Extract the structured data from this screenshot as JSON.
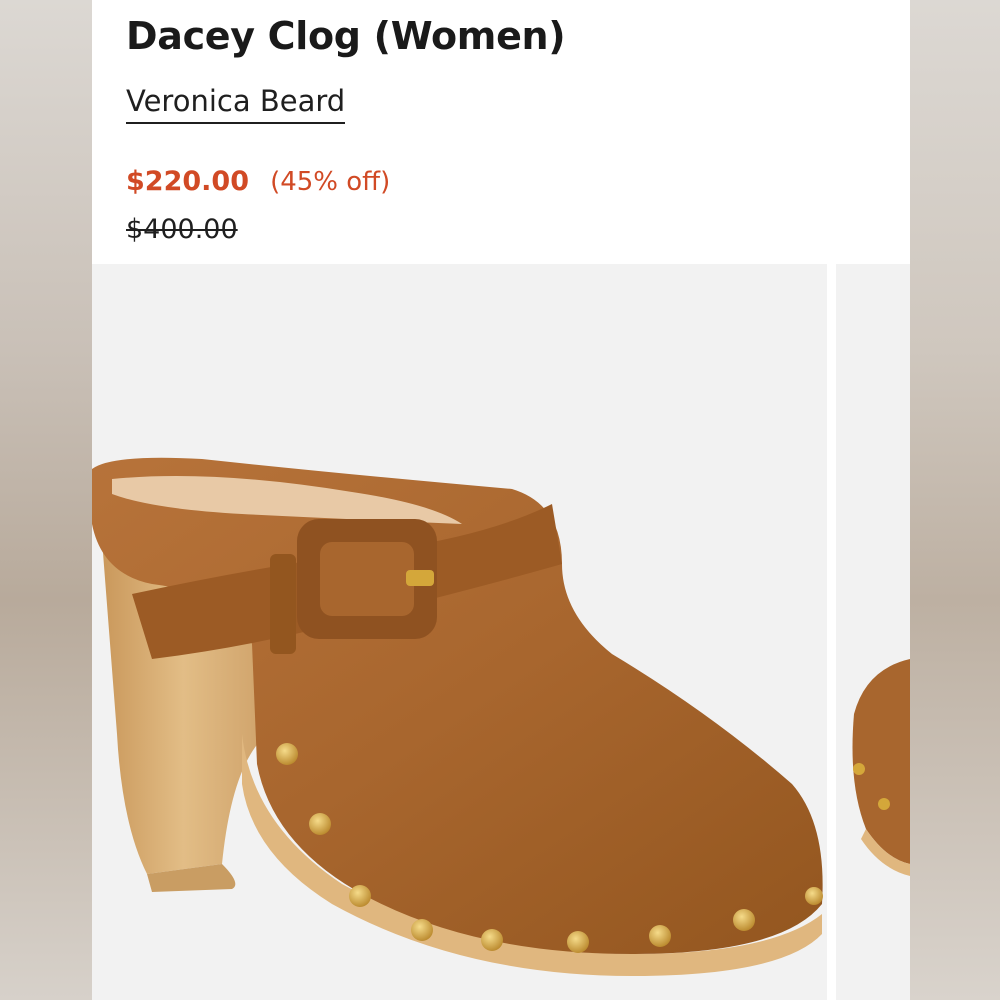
{
  "product": {
    "title": "Dacey Clog (Women)",
    "brand": "Veronica Beard",
    "sale_price": "$220.00",
    "discount": "(45% off)",
    "original_price": "$400.00"
  },
  "colors": {
    "sale": "#d14a25",
    "text": "#1a1a1a",
    "suede": "#a8662e",
    "wood": "#d9b27a",
    "stud": "#d4a73a"
  },
  "images": [
    {
      "subject": "tan suede clog with buckle strap, wooden heel and gold studs"
    },
    {
      "subject": "tan suede clog, partial view"
    }
  ]
}
